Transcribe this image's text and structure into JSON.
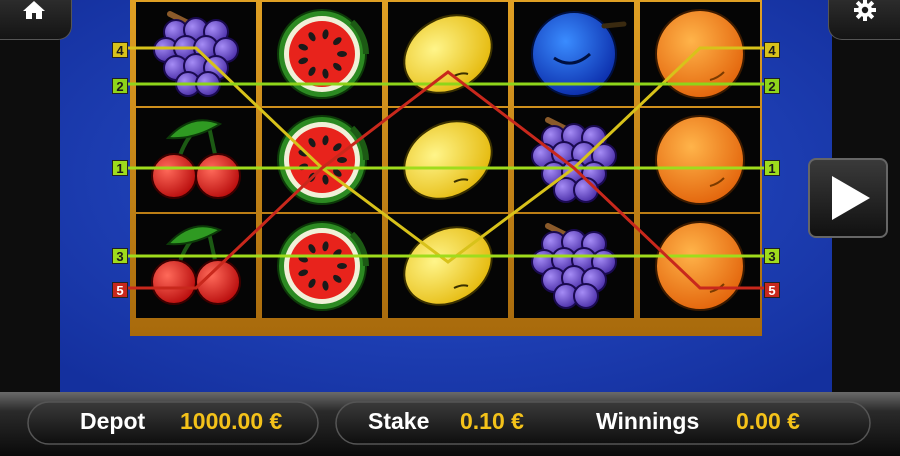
{
  "reels": [
    [
      "grapes",
      "cherries",
      "cherries"
    ],
    [
      "watermelon",
      "watermelon",
      "watermelon"
    ],
    [
      "lemon",
      "lemon",
      "lemon"
    ],
    [
      "plum",
      "grapes",
      "grapes"
    ],
    [
      "orange",
      "orange",
      "orange"
    ]
  ],
  "paylines": [
    {
      "label": "4",
      "color": "#d8c21a"
    },
    {
      "label": "2",
      "color": "#8fd51a"
    },
    {
      "label": "1",
      "color": "#9fdc1c"
    },
    {
      "label": "3",
      "color": "#9fdc1c"
    },
    {
      "label": "5",
      "color": "#c8281c"
    }
  ],
  "footer": {
    "depot_label": "Depot",
    "depot_value": "1000.00 €",
    "stake_label": "Stake",
    "stake_value": "0.10 €",
    "winnings_label": "Winnings",
    "winnings_value": "0.00 €"
  },
  "icons": {
    "home": "home-icon",
    "settings": "gear-icon",
    "spin": "play-icon"
  },
  "colors": {
    "background_blue": "#1c3fb8",
    "frame_gold": "#c98a14",
    "value_gold": "#f4c21a"
  }
}
